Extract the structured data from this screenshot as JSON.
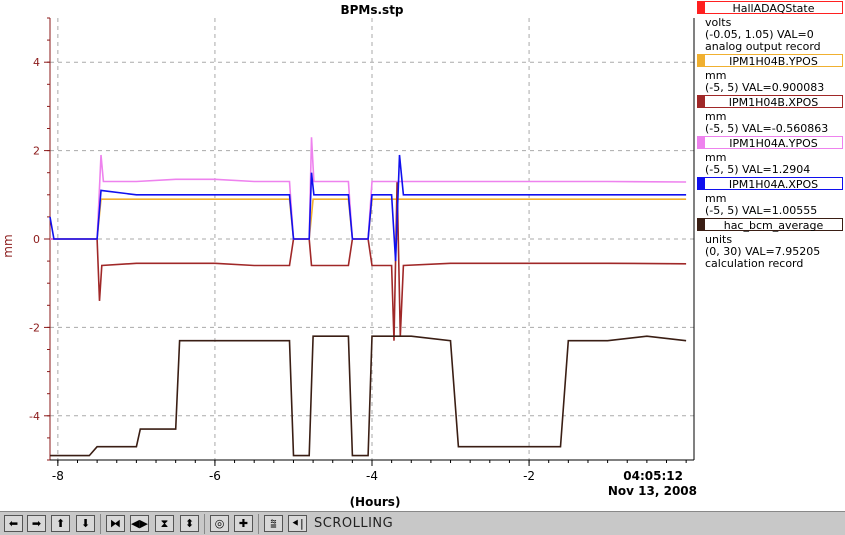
{
  "toolbar": {
    "status_label": "SCROLLING",
    "buttons": [
      {
        "name": "scroll-left-button",
        "glyph": "⬅"
      },
      {
        "name": "scroll-right-button",
        "glyph": "➡"
      },
      {
        "name": "scroll-up-button",
        "glyph": "⬆"
      },
      {
        "name": "scroll-down-button",
        "glyph": "⬇"
      },
      {
        "name": "compress-horizontal-button",
        "glyph": "⧓"
      },
      {
        "name": "expand-horizontal-button",
        "glyph": "◀▶"
      },
      {
        "name": "compress-vertical-button",
        "glyph": "⧗"
      },
      {
        "name": "expand-vertical-button",
        "glyph": "⬍"
      },
      {
        "name": "zoom-reset-button",
        "glyph": "◎"
      },
      {
        "name": "zoom-plus-button",
        "glyph": "✚"
      },
      {
        "name": "autoscale-button",
        "glyph": "⩰"
      },
      {
        "name": "scroll-mode-button",
        "glyph": "⯇|"
      }
    ]
  },
  "chart_data": {
    "type": "line",
    "title": "BPMs.stp",
    "xlabel": "(Hours)",
    "ylabel": "mm",
    "xlim": [
      -8.1,
      0.1
    ],
    "ylim": [
      -5,
      5
    ],
    "x_ticks": [
      -8,
      -6,
      -4,
      -2
    ],
    "y_ticks": [
      -4,
      -2,
      0,
      2,
      4
    ],
    "x_tick_labels": [
      "-8",
      "-6",
      "-4",
      "-2"
    ],
    "y_tick_labels": [
      "-4",
      "-2",
      "0",
      "2",
      "4"
    ],
    "time_label": "04:05:12",
    "date_label": "Nov 13, 2008",
    "grid": true,
    "colors": {
      "axis_left": "#8b1a1a",
      "grid": "#aaaaaa"
    },
    "series": [
      {
        "name": "HallADAQState",
        "units": "volts",
        "range": "(-0.05, 1.05)",
        "value_text": "VAL=0",
        "desc": "analog output record",
        "color": "#ff2020"
      },
      {
        "name": "IPM1H04B.YPOS",
        "units": "mm",
        "range": "(-5, 5)",
        "value_text": "VAL=0.900083",
        "desc": "",
        "color": "#f0b030",
        "points": [
          [
            -8.1,
            0
          ],
          [
            -7.5,
            0
          ],
          [
            -7.45,
            0.9
          ],
          [
            -7.0,
            0.9
          ],
          [
            -6.5,
            0.9
          ],
          [
            -6.0,
            0.9
          ],
          [
            -5.5,
            0.9
          ],
          [
            -5.05,
            0.9
          ],
          [
            -5.0,
            0
          ],
          [
            -4.8,
            0
          ],
          [
            -4.75,
            0.9
          ],
          [
            -4.5,
            0.9
          ],
          [
            -4.3,
            0.9
          ],
          [
            -4.25,
            0
          ],
          [
            -4.05,
            0
          ],
          [
            -4.0,
            0.9
          ],
          [
            -3.7,
            0.9
          ],
          [
            -3.5,
            0.9
          ],
          [
            -3.0,
            0.9
          ],
          [
            -2.0,
            0.9
          ],
          [
            -1.0,
            0.9
          ],
          [
            0.0,
            0.9
          ]
        ]
      },
      {
        "name": "IPM1H04B.XPOS",
        "units": "mm",
        "range": "(-5, 5)",
        "value_text": "VAL=-0.560863",
        "desc": "",
        "color": "#a02828",
        "points": [
          [
            -8.1,
            0
          ],
          [
            -7.5,
            0
          ],
          [
            -7.47,
            -1.4
          ],
          [
            -7.44,
            -0.6
          ],
          [
            -7.0,
            -0.55
          ],
          [
            -6.5,
            -0.55
          ],
          [
            -6.0,
            -0.55
          ],
          [
            -5.5,
            -0.6
          ],
          [
            -5.05,
            -0.6
          ],
          [
            -5.0,
            0
          ],
          [
            -4.8,
            0
          ],
          [
            -4.77,
            -0.6
          ],
          [
            -4.5,
            -0.6
          ],
          [
            -4.3,
            -0.6
          ],
          [
            -4.25,
            0
          ],
          [
            -4.05,
            0
          ],
          [
            -4.0,
            -0.6
          ],
          [
            -3.75,
            -0.6
          ],
          [
            -3.72,
            -2.3
          ],
          [
            -3.68,
            1.3
          ],
          [
            -3.64,
            -2.2
          ],
          [
            -3.6,
            -0.6
          ],
          [
            -3.0,
            -0.55
          ],
          [
            -2.0,
            -0.55
          ],
          [
            -1.0,
            -0.55
          ],
          [
            0.0,
            -0.56
          ]
        ]
      },
      {
        "name": "IPM1H04A.YPOS",
        "units": "mm",
        "range": "(-5, 5)",
        "value_text": "VAL=1.2904",
        "desc": "",
        "color": "#ee82ee",
        "points": [
          [
            -8.1,
            0
          ],
          [
            -7.5,
            0
          ],
          [
            -7.45,
            1.9
          ],
          [
            -7.42,
            1.3
          ],
          [
            -7.0,
            1.3
          ],
          [
            -6.5,
            1.35
          ],
          [
            -6.0,
            1.35
          ],
          [
            -5.5,
            1.3
          ],
          [
            -5.05,
            1.3
          ],
          [
            -5.0,
            0
          ],
          [
            -4.8,
            0
          ],
          [
            -4.77,
            2.3
          ],
          [
            -4.74,
            1.3
          ],
          [
            -4.5,
            1.3
          ],
          [
            -4.3,
            1.3
          ],
          [
            -4.25,
            0
          ],
          [
            -4.05,
            0
          ],
          [
            -4.0,
            1.3
          ],
          [
            -3.5,
            1.3
          ],
          [
            -3.0,
            1.3
          ],
          [
            -2.0,
            1.3
          ],
          [
            -1.0,
            1.3
          ],
          [
            0.0,
            1.29
          ]
        ]
      },
      {
        "name": "IPM1H04A.XPOS",
        "units": "mm",
        "range": "(-5, 5)",
        "value_text": "VAL=1.00555",
        "desc": "",
        "color": "#1010ee",
        "points": [
          [
            -8.1,
            0.5
          ],
          [
            -8.05,
            0
          ],
          [
            -7.5,
            0
          ],
          [
            -7.45,
            1.1
          ],
          [
            -7.0,
            1.0
          ],
          [
            -6.5,
            1.0
          ],
          [
            -6.0,
            1.0
          ],
          [
            -5.5,
            1.0
          ],
          [
            -5.05,
            1.0
          ],
          [
            -5.0,
            0
          ],
          [
            -4.8,
            0
          ],
          [
            -4.77,
            1.5
          ],
          [
            -4.74,
            1.0
          ],
          [
            -4.5,
            1.0
          ],
          [
            -4.3,
            1.0
          ],
          [
            -4.25,
            0
          ],
          [
            -4.05,
            0
          ],
          [
            -4.0,
            1.0
          ],
          [
            -3.75,
            1.0
          ],
          [
            -3.7,
            -0.5
          ],
          [
            -3.65,
            1.9
          ],
          [
            -3.6,
            1.0
          ],
          [
            -3.0,
            1.0
          ],
          [
            -2.0,
            1.0
          ],
          [
            -1.0,
            1.0
          ],
          [
            0.0,
            1.0
          ]
        ]
      },
      {
        "name": "hac_bcm_average",
        "units": "units",
        "range": "(0, 30)",
        "value_text": "VAL=7.95205",
        "desc": "calculation record",
        "color": "#3a1e14",
        "points": [
          [
            -8.1,
            -4.9
          ],
          [
            -7.6,
            -4.9
          ],
          [
            -7.5,
            -4.7
          ],
          [
            -7.0,
            -4.7
          ],
          [
            -6.95,
            -4.3
          ],
          [
            -6.5,
            -4.3
          ],
          [
            -6.45,
            -2.3
          ],
          [
            -6.0,
            -2.3
          ],
          [
            -5.5,
            -2.3
          ],
          [
            -5.05,
            -2.3
          ],
          [
            -5.0,
            -4.9
          ],
          [
            -4.8,
            -4.9
          ],
          [
            -4.75,
            -2.2
          ],
          [
            -4.3,
            -2.2
          ],
          [
            -4.25,
            -4.9
          ],
          [
            -4.05,
            -4.9
          ],
          [
            -4.0,
            -2.2
          ],
          [
            -3.5,
            -2.2
          ],
          [
            -3.0,
            -2.3
          ],
          [
            -2.9,
            -4.7
          ],
          [
            -2.5,
            -4.7
          ],
          [
            -2.0,
            -4.7
          ],
          [
            -1.6,
            -4.7
          ],
          [
            -1.5,
            -2.3
          ],
          [
            -1.0,
            -2.3
          ],
          [
            -0.5,
            -2.2
          ],
          [
            0.0,
            -2.3
          ]
        ]
      }
    ]
  }
}
